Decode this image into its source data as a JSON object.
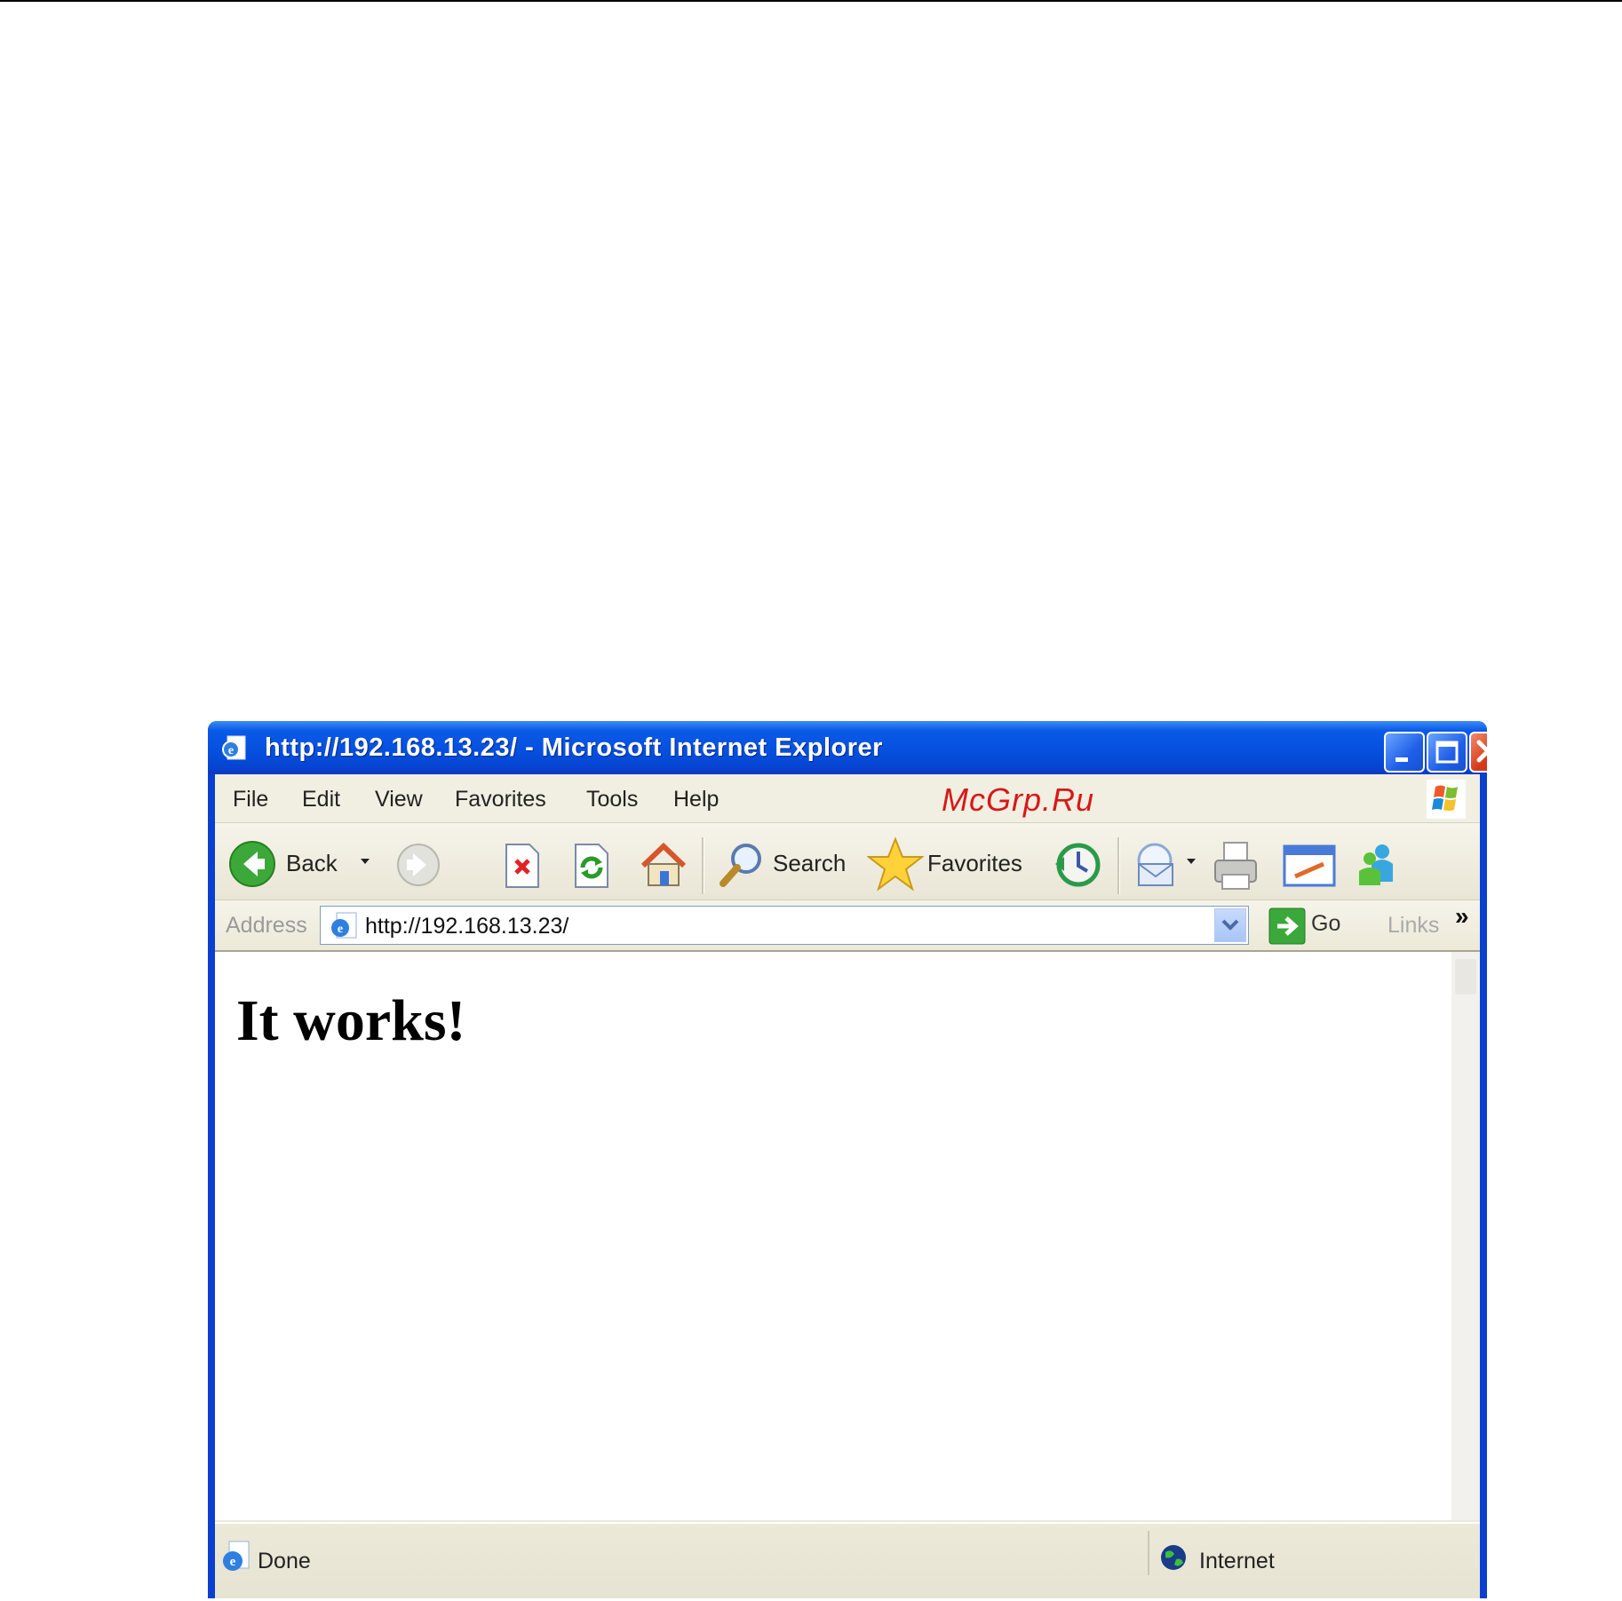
{
  "window": {
    "title": "http://192.168.13.23/ - Microsoft Internet Explorer",
    "title_color": "#0a52e0"
  },
  "menubar": {
    "items": [
      "File",
      "Edit",
      "View",
      "Favorites",
      "Tools",
      "Help"
    ]
  },
  "watermark": "McGrp.Ru",
  "toolbar": {
    "back_label": "Back",
    "search_label": "Search",
    "favorites_label": "Favorites",
    "icons": [
      "back-arrow-icon",
      "forward-arrow-icon",
      "stop-icon",
      "refresh-icon",
      "home-icon",
      "search-icon",
      "favorites-star-icon",
      "history-icon",
      "mail-icon",
      "print-icon",
      "edit-icon",
      "messenger-icon"
    ]
  },
  "addressbar": {
    "label": "Address",
    "url": "http://192.168.13.23/",
    "go_label": "Go",
    "links_label": "Links",
    "more": "»"
  },
  "page": {
    "heading": "It works!"
  },
  "statusbar": {
    "status": "Done",
    "zone": "Internet"
  }
}
